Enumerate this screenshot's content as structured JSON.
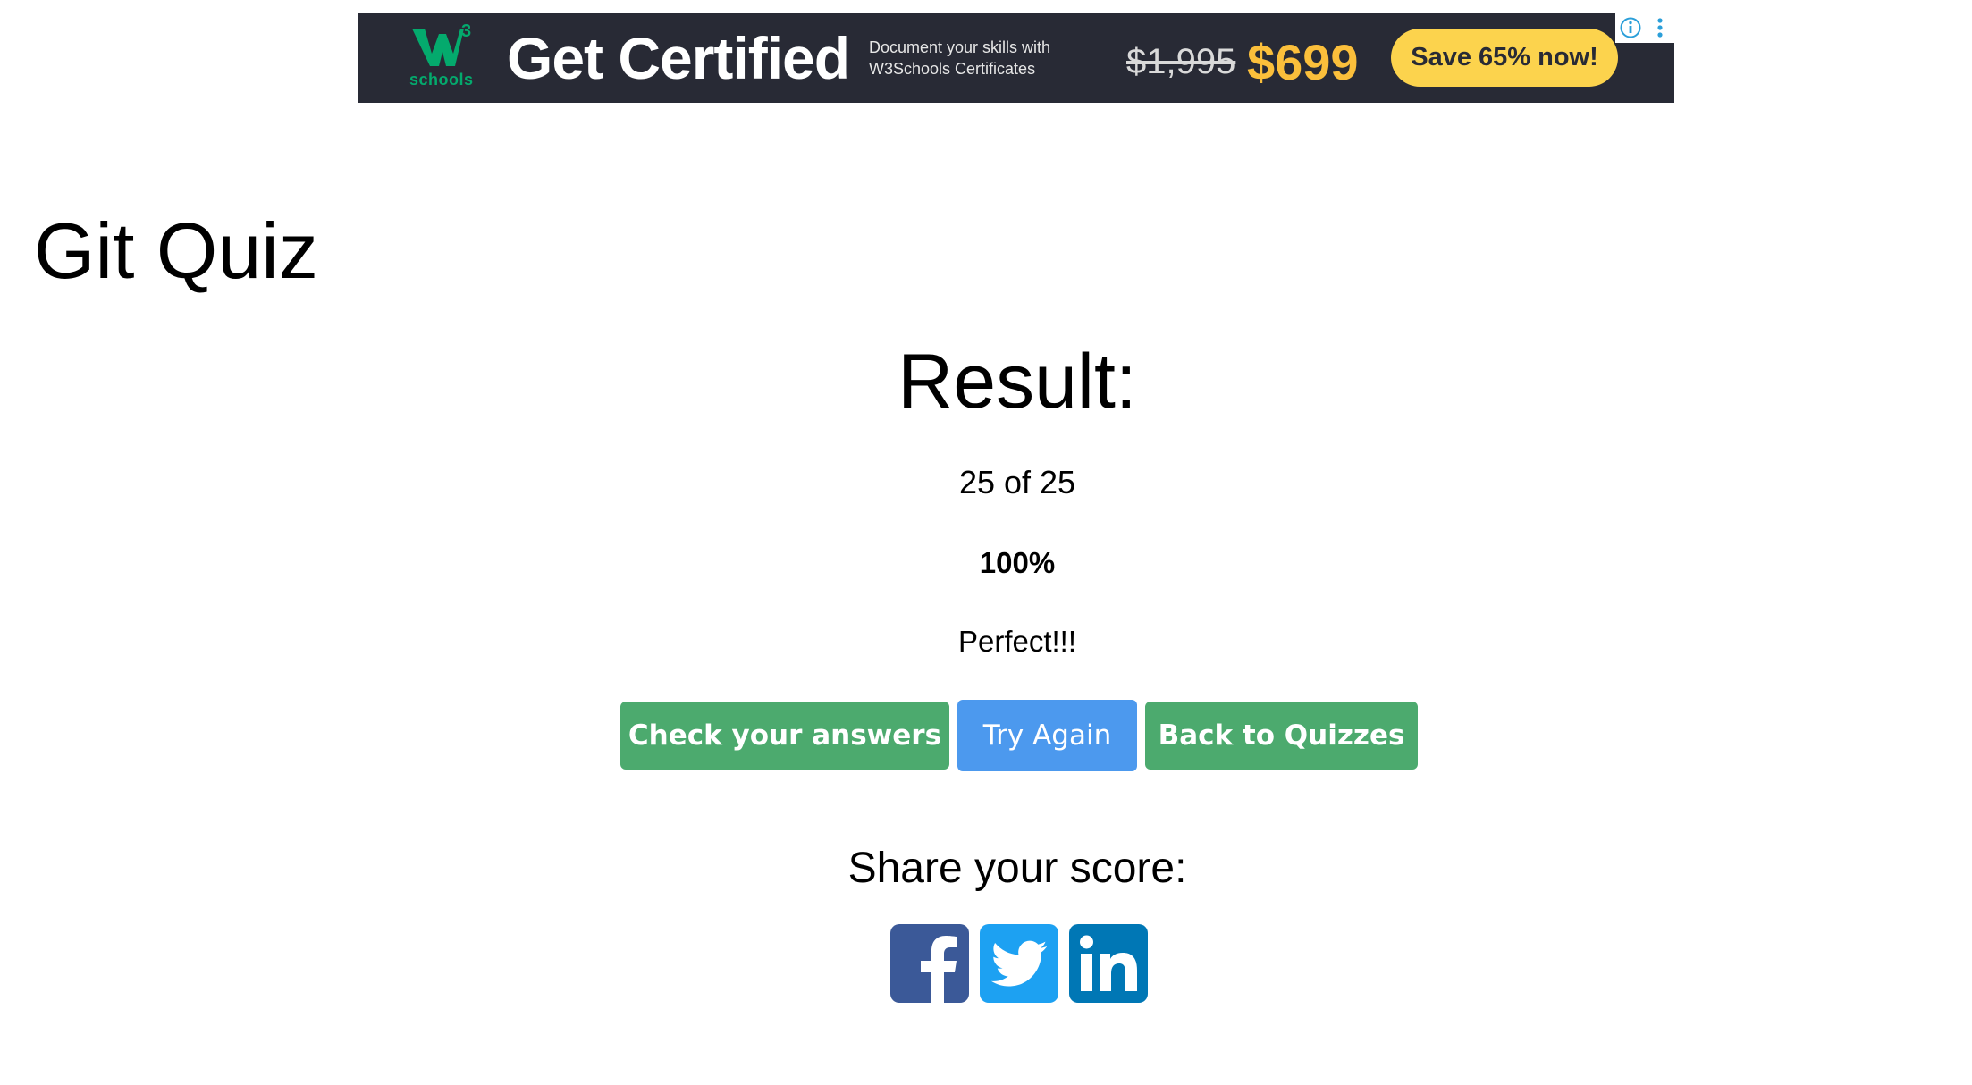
{
  "ad": {
    "logo_text": "schools",
    "logo_superscript": "3",
    "headline": "Get Certified",
    "subtext": "Document your skills with W3Schools Certificates",
    "old_price": "$1,995",
    "new_price": "$699",
    "cta": "Save 65% now!",
    "colors": {
      "background": "#282a35",
      "accent": "#04aa6d",
      "price": "#fbbf3b",
      "cta": "#fcd34d"
    },
    "icons": [
      "w3schools-logo-icon",
      "adchoices-info-icon",
      "more-options-icon"
    ]
  },
  "page": {
    "title": "Git Quiz"
  },
  "result": {
    "heading": "Result:",
    "score": "25 of 25",
    "percent": "100%",
    "message": "Perfect!!!"
  },
  "actions": {
    "check_label": "Check your answers",
    "retry_label": "Try Again",
    "back_label": "Back to Quizzes",
    "colors": {
      "green": "#4caa6e",
      "blue": "#4c99ee"
    }
  },
  "share": {
    "heading": "Share your score:",
    "networks": [
      "facebook-icon",
      "twitter-icon",
      "linkedin-icon"
    ]
  }
}
